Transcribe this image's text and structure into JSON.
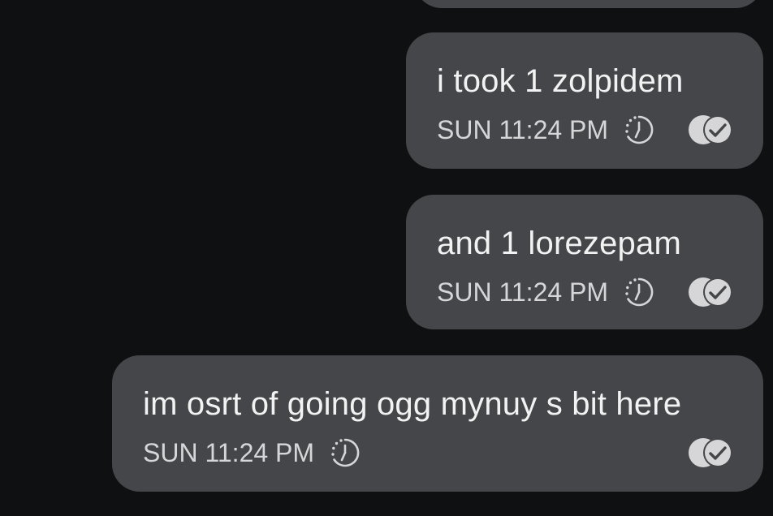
{
  "messages": [
    {
      "text": "i took 1 zolpidem",
      "time": "SUN 11:24 PM",
      "timer_icon": "expiring-timer-icon",
      "status_icon": "read-receipt-icon"
    },
    {
      "text": "and 1 lorezepam",
      "time": "SUN 11:24 PM",
      "timer_icon": "expiring-timer-icon",
      "status_icon": "read-receipt-icon"
    },
    {
      "text": "im osrt of going ogg mynuy s bit here",
      "time": "SUN 11:24 PM",
      "timer_icon": "expiring-timer-icon",
      "status_icon": "read-receipt-icon"
    }
  ],
  "colors": {
    "background": "#0f1012",
    "bubble": "#454649",
    "text": "#f2f2f3",
    "meta": "#d6d6d8"
  }
}
